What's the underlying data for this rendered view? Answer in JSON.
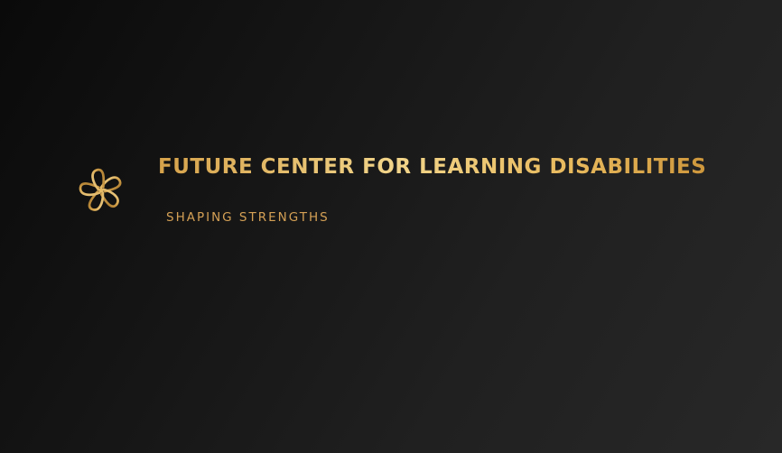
{
  "brand": {
    "title": "FUTURE CENTER FOR LEARNING DISABILITIES",
    "tagline": "SHAPING STRENGTHS",
    "emblem_icon": "gold-flower-knot-icon"
  },
  "colors": {
    "background_dark": "#0a0a0a",
    "background_light": "#282828",
    "gold_light": "#f2d58a",
    "gold_mid": "#e0b062",
    "gold_dark": "#b8822e"
  }
}
